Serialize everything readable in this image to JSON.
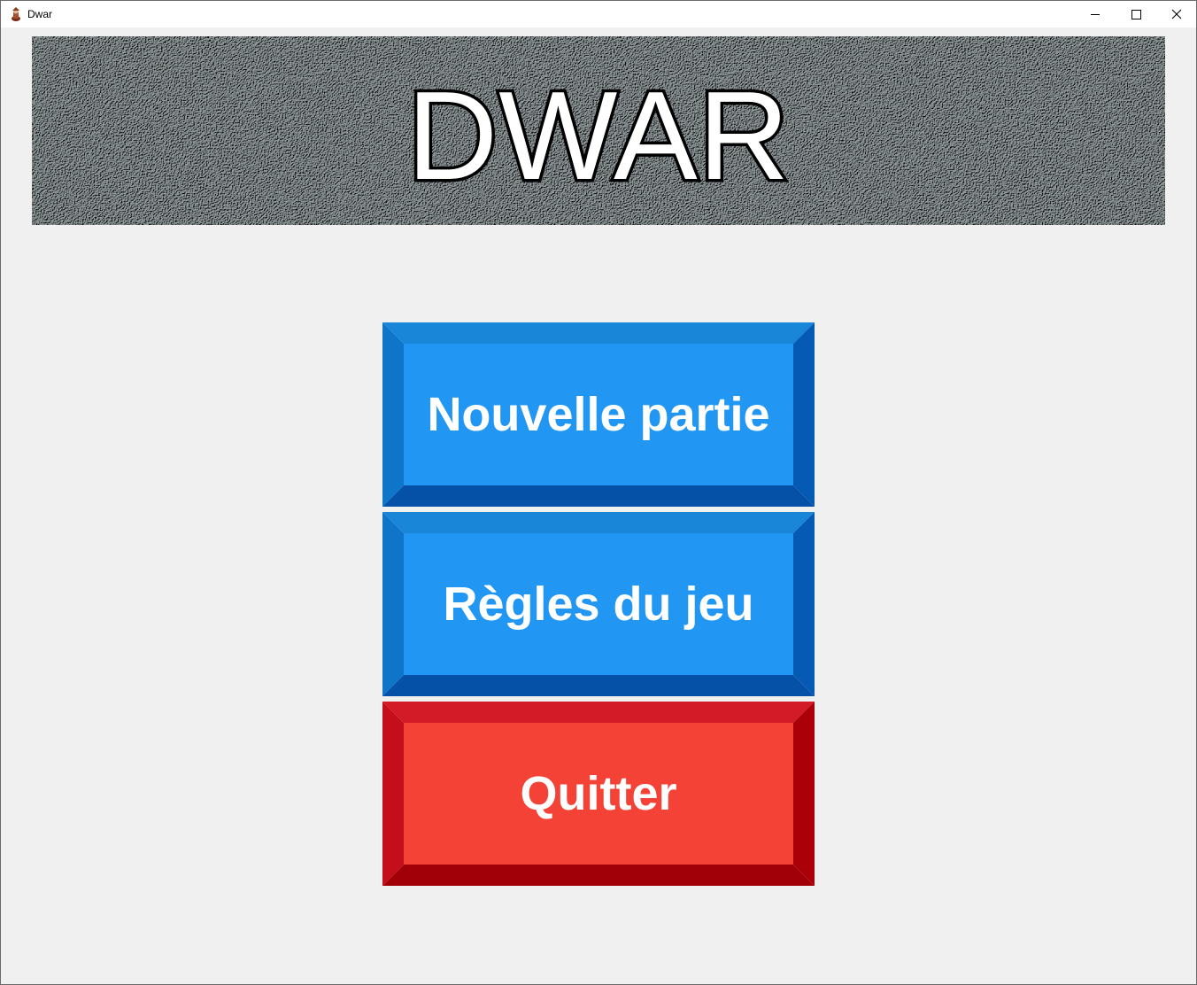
{
  "window": {
    "title": "Dwar",
    "controls": [
      "minimize-icon",
      "maximize-icon",
      "close-icon"
    ]
  },
  "banner": {
    "title": "DWAR"
  },
  "menu": {
    "new_game_label": "Nouvelle partie",
    "rules_label": "Règles du jeu",
    "quit_label": "Quitter"
  },
  "colors": {
    "primary_button": "#2196f3",
    "danger_button": "#f44336",
    "background": "#f0f0f0",
    "banner_stone": "#7d8586"
  }
}
